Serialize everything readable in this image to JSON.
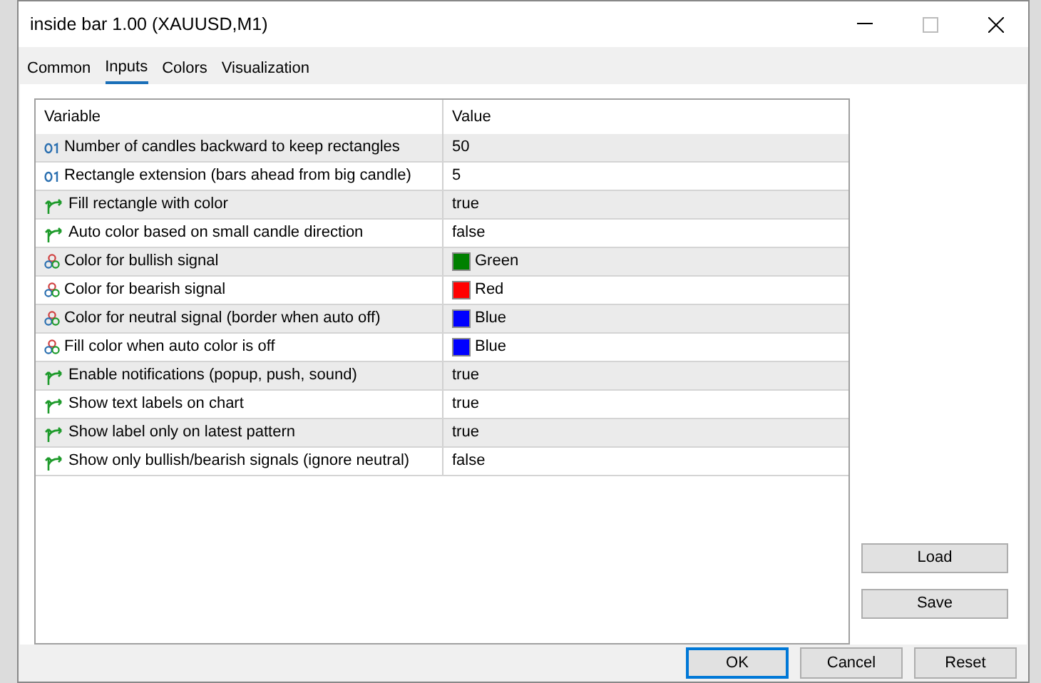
{
  "window": {
    "title": "inside bar 1.00 (XAUUSD,M1)"
  },
  "tabs": [
    {
      "label": "Common",
      "selected": false
    },
    {
      "label": "Inputs",
      "selected": true
    },
    {
      "label": "Colors",
      "selected": false
    },
    {
      "label": "Visualization",
      "selected": false
    }
  ],
  "table": {
    "columns": [
      "Variable",
      "Value"
    ],
    "rows": [
      {
        "kind": "int",
        "variable": "Number of candles backward to keep rectangles",
        "value": "50"
      },
      {
        "kind": "int",
        "variable": "Rectangle extension (bars ahead from big candle)",
        "value": "5"
      },
      {
        "kind": "bool",
        "variable": "Fill rectangle with color",
        "value": "true"
      },
      {
        "kind": "bool",
        "variable": "Auto color based on small candle direction",
        "value": "false"
      },
      {
        "kind": "color",
        "variable": "Color for bullish signal",
        "value": "Green",
        "color": "#008000"
      },
      {
        "kind": "color",
        "variable": "Color for bearish signal",
        "value": "Red",
        "color": "#ff0000"
      },
      {
        "kind": "color",
        "variable": "Color for neutral signal (border when auto off)",
        "value": "Blue",
        "color": "#0000ff"
      },
      {
        "kind": "color",
        "variable": "Fill color when auto color is off",
        "value": "Blue",
        "color": "#0000ff"
      },
      {
        "kind": "bool",
        "variable": "Enable notifications (popup, push, sound)",
        "value": "true"
      },
      {
        "kind": "bool",
        "variable": "Show text labels on chart",
        "value": "true"
      },
      {
        "kind": "bool",
        "variable": "Show label only on latest pattern",
        "value": "true"
      },
      {
        "kind": "bool",
        "variable": "Show only bullish/bearish signals (ignore neutral)",
        "value": "false"
      }
    ]
  },
  "side_buttons": [
    "Load",
    "Save"
  ],
  "buttons": [
    {
      "label": "OK",
      "default": true
    },
    {
      "label": "Cancel",
      "default": false
    },
    {
      "label": "Reset",
      "default": false
    }
  ]
}
